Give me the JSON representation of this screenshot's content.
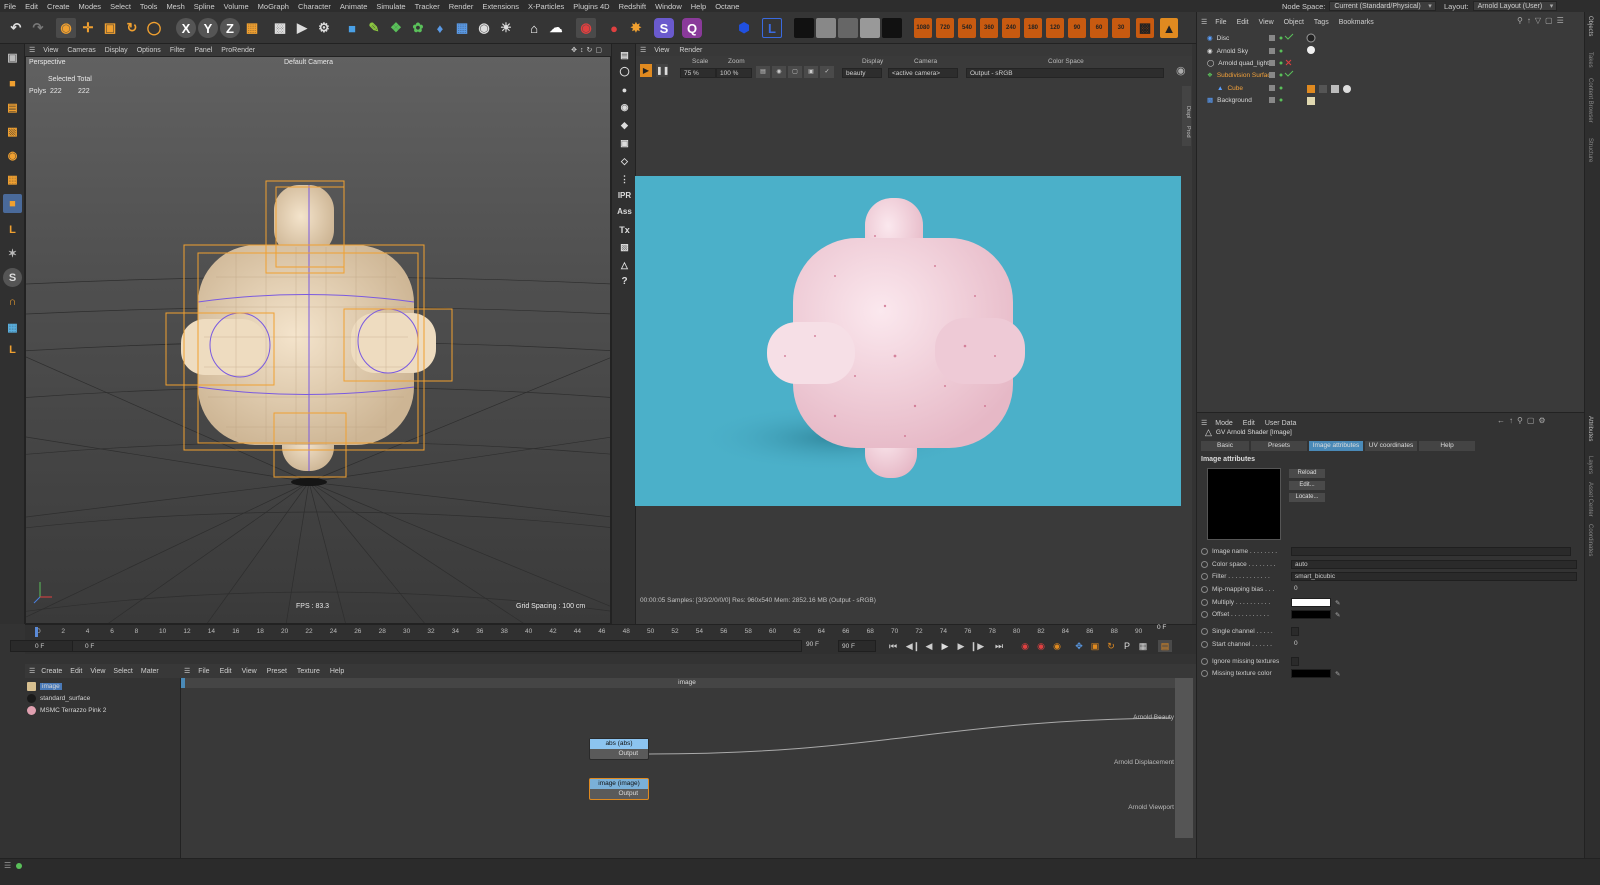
{
  "menubar": {
    "items": [
      "File",
      "Edit",
      "Create",
      "Modes",
      "Select",
      "Tools",
      "Mesh",
      "Spline",
      "Volume",
      "MoGraph",
      "Character",
      "Animate",
      "Simulate",
      "Tracker",
      "Render",
      "Extensions",
      "X-Particles",
      "Plugins 4D",
      "Redshift",
      "Window",
      "Help",
      "Octane"
    ],
    "node_space_label": "Node Space:",
    "node_space_value": "Current (Standard/Physical)",
    "layout_label": "Layout:",
    "layout_value": "Arnold Layout (User)"
  },
  "toolbar": {
    "axes": [
      "X",
      "Y",
      "Z"
    ],
    "render_presets": [
      "1080",
      "720",
      "540",
      "360",
      "240",
      "180",
      "120",
      "90",
      "60",
      "30"
    ]
  },
  "viewport": {
    "menu": [
      "View",
      "Cameras",
      "Display",
      "Options",
      "Filter",
      "Panel",
      "ProRender"
    ],
    "name": "Perspective",
    "camera": "Default Camera",
    "selected_total_label": "Selected Total",
    "polys_label": "Polys",
    "polys_selected": "222",
    "polys_total": "222",
    "fps": "FPS : 83.3",
    "grid_spacing": "Grid Spacing : 100 cm"
  },
  "render_view": {
    "menu": [
      "View",
      "Render"
    ],
    "scale_label": "Scale",
    "scale_value": "75 %",
    "zoom_label": "Zoom",
    "zoom_value": "100 %",
    "display_label": "Display",
    "display_value": "beauty",
    "camera_label": "Camera",
    "camera_value": "<active camera>",
    "colorspace_label": "Color Space",
    "colorspace_value": "Output - sRGB",
    "status": "00:00:05  Samples: [3/3/2/0/0/0]  Res: 960x540  Mem: 2852.16 MB  (Output - sRGB)",
    "bg_color": "#4bb0c9",
    "side_labels": [
      "Display",
      "Prod"
    ]
  },
  "midbar": {
    "labels": [
      "IPR",
      "Ass",
      "Tx",
      "?"
    ]
  },
  "object_manager": {
    "menu": [
      "File",
      "Edit",
      "View",
      "Object",
      "Tags",
      "Bookmarks"
    ],
    "objects": [
      {
        "name": "Disc",
        "color": "#5aa0ff"
      },
      {
        "name": "Arnold Sky",
        "color": "#d8d8d8"
      },
      {
        "name": "Arnold quad_light",
        "color": "#d8d8d8"
      },
      {
        "name": "Subdivision Surface",
        "color": "#f2a13a"
      },
      {
        "name": "Cube",
        "color": "#f2a13a"
      },
      {
        "name": "Background",
        "color": "#d8d8d8"
      }
    ]
  },
  "attributes": {
    "menu": [
      "Mode",
      "Edit",
      "User Data"
    ],
    "shader_title": "GV Arnold Shader [Image]",
    "tabs": [
      "Basic",
      "Presets",
      "Image attributes",
      "UV coordinates",
      "Help"
    ],
    "active_tab": "Image attributes",
    "section": "Image attributes",
    "buttons": [
      "Reload",
      "Edit...",
      "Locate..."
    ],
    "rows": [
      {
        "label": "Image name . . . . . . . .",
        "value": ""
      },
      {
        "label": "Color space . . . . . . . .",
        "value": "auto"
      },
      {
        "label": "Filter . . . . . . . . . . . .",
        "value": "smart_bicubic"
      },
      {
        "label": "Mip-mapping bias . . .",
        "value": "0"
      },
      {
        "label": "Multiply . . . . . . . . . .",
        "value": ""
      },
      {
        "label": "Offset . . . . . . . . . . .",
        "value": ""
      },
      {
        "label": "Single channel . . . . .",
        "value": ""
      },
      {
        "label": "Start channel . . . . . .",
        "value": "0"
      },
      {
        "label": "Ignore missing textures",
        "value": ""
      },
      {
        "label": "Missing texture color",
        "value": ""
      }
    ],
    "right_sidebar": [
      "Objects",
      "Takes",
      "Content Browser",
      "Structure"
    ],
    "right_sidebar_lower": [
      "Attributes",
      "Layers",
      "Asset Center",
      "Coordinates"
    ]
  },
  "timeline": {
    "ticks": [
      "0",
      "2",
      "4",
      "6",
      "8",
      "10",
      "12",
      "14",
      "16",
      "18",
      "20",
      "22",
      "24",
      "26",
      "28",
      "30",
      "32",
      "34",
      "36",
      "38",
      "40",
      "42",
      "44",
      "46",
      "48",
      "50",
      "52",
      "54",
      "56",
      "58",
      "60",
      "62",
      "64",
      "66",
      "68",
      "70",
      "72",
      "74",
      "76",
      "78",
      "80",
      "82",
      "84",
      "86",
      "88",
      "90"
    ],
    "current": "0 F",
    "start": "0 F",
    "start2": "0 F",
    "end": "90 F",
    "end2": "90 F"
  },
  "material_manager": {
    "menu": [
      "Create",
      "Edit",
      "View",
      "Select",
      "Mater"
    ],
    "items": [
      {
        "name": "image",
        "color": "#d8c090"
      },
      {
        "name": "standard_surface",
        "color": "#1a1a1a"
      },
      {
        "name": "MSMC Terrazzo Pink 2",
        "color": "#e0a0b0"
      }
    ]
  },
  "node_editor": {
    "menu": [
      "File",
      "Edit",
      "View",
      "Preset",
      "Texture",
      "Help"
    ],
    "title": "image",
    "nodes": [
      {
        "title": "abs (abs)",
        "output": "Output",
        "color": "#8cc4f0"
      },
      {
        "title": "image (image)",
        "output": "Output",
        "color": "#7ab0d8"
      }
    ],
    "ports": [
      "Arnold Beauty",
      "Arnold Displacement",
      "Arnold Viewport"
    ]
  }
}
